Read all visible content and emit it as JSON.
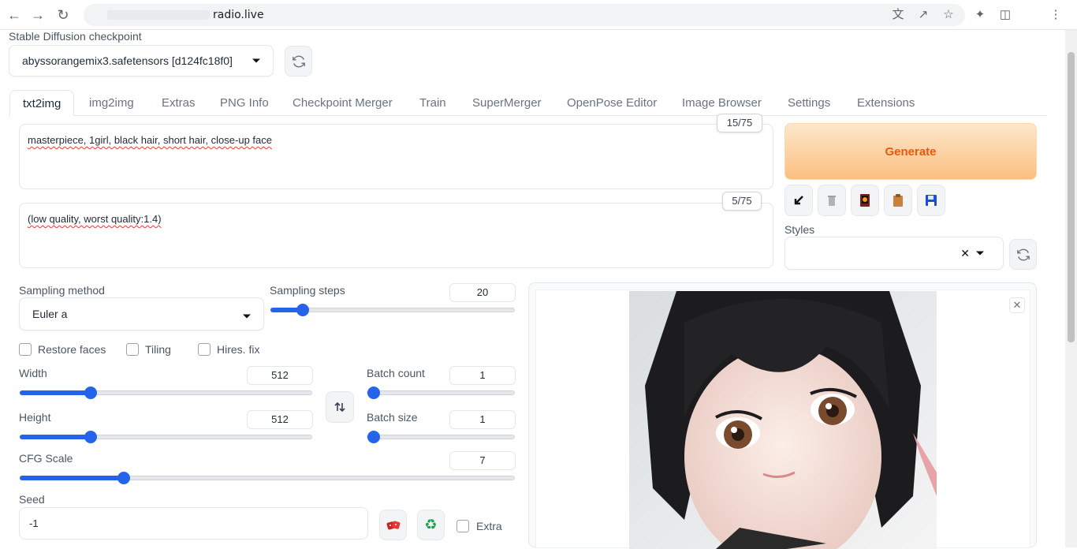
{
  "browser": {
    "url": "radio.live"
  },
  "checkpoint": {
    "label": "Stable Diffusion checkpoint",
    "value": "abyssorangemix3.safetensors [d124fc18f0]"
  },
  "tabs": [
    "txt2img",
    "img2img",
    "Extras",
    "PNG Info",
    "Checkpoint Merger",
    "Train",
    "SuperMerger",
    "OpenPose Editor",
    "Image Browser",
    "Settings",
    "Extensions"
  ],
  "prompt": {
    "positive": "masterpiece, 1girl, black hair, short hair, close-up face",
    "positive_count": "15/75",
    "negative": "(low quality, worst quality:1.4)",
    "negative_count": "5/75"
  },
  "actions": {
    "generate_label": "Generate",
    "styles_label": "Styles"
  },
  "sampling": {
    "method_label": "Sampling method",
    "method_value": "Euler a",
    "steps_label": "Sampling steps",
    "steps_value": "20",
    "steps_fraction": 0.13
  },
  "options": {
    "restore_faces": "Restore faces",
    "tiling": "Tiling",
    "hires_fix": "Hires. fix"
  },
  "size": {
    "width_label": "Width",
    "width_value": "512",
    "width_fraction": 0.24,
    "height_label": "Height",
    "height_value": "512",
    "height_fraction": 0.24
  },
  "batch": {
    "count_label": "Batch count",
    "count_value": "1",
    "count_fraction": 0.0,
    "size_label": "Batch size",
    "size_value": "1",
    "size_fraction": 0.0
  },
  "cfg": {
    "label": "CFG Scale",
    "value": "7",
    "fraction": 0.21
  },
  "seed": {
    "label": "Seed",
    "value": "-1",
    "extra_label": "Extra"
  },
  "colors": {
    "accent": "#2563eb",
    "generate_text": "#ea580c"
  }
}
